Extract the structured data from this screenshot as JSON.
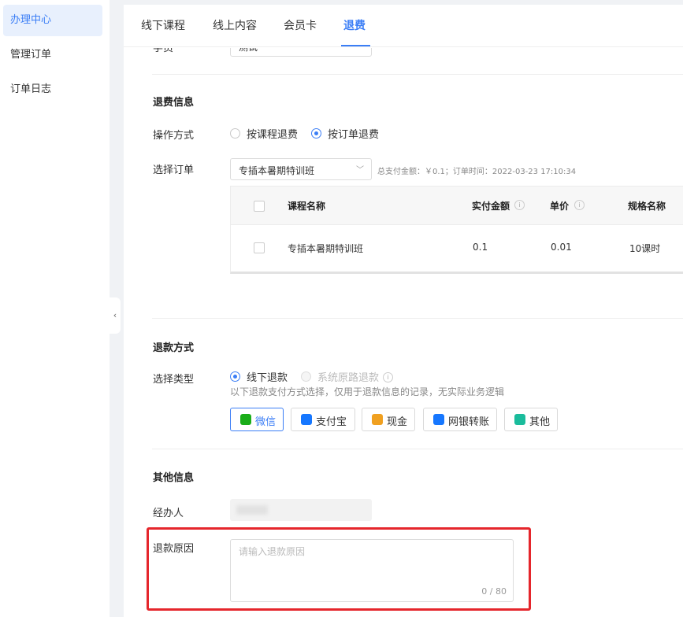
{
  "sidebar": {
    "items": [
      {
        "label": "办理中心"
      },
      {
        "label": "管理订单"
      },
      {
        "label": "订单日志"
      }
    ]
  },
  "tabs": [
    {
      "label": "线下课程"
    },
    {
      "label": "线上内容"
    },
    {
      "label": "会员卡"
    },
    {
      "label": "退费"
    }
  ],
  "top_partial": {
    "label": "学员",
    "value": "测试"
  },
  "refund_info": {
    "title": "退费信息",
    "operation_label": "操作方式",
    "operation_options": [
      "按课程退费",
      "按订单退费"
    ],
    "order_label": "选择订单",
    "order_selected": "专插本暑期特训班",
    "order_hint": "总支付金额：￥0.1；订单时间：2022-03-23 17:10:34"
  },
  "order_table": {
    "columns": [
      "课程名称",
      "实付金额",
      "单价",
      "规格名称"
    ],
    "rows": [
      {
        "name": "专插本暑期特训班",
        "paid": "0.1",
        "unit_price": "0.01",
        "spec": "10课时"
      }
    ]
  },
  "refund_method": {
    "title": "退款方式",
    "type_label": "选择类型",
    "options": [
      "线下退款",
      "系统原路退款"
    ],
    "note": "以下退款支付方式选择，仅用于退款信息的记录，无实际业务逻辑",
    "pay_methods": [
      {
        "label": "微信",
        "icon": "wechat-icon",
        "color": "#1aad19"
      },
      {
        "label": "支付宝",
        "icon": "alipay-icon",
        "color": "#1677ff"
      },
      {
        "label": "现金",
        "icon": "cash-icon",
        "color": "#f0a020"
      },
      {
        "label": "网银转账",
        "icon": "bank-card-icon",
        "color": "#1677ff"
      },
      {
        "label": "其他",
        "icon": "grid-icon",
        "color": "#1abc9c"
      }
    ]
  },
  "other_info": {
    "title": "其他信息",
    "handler_label": "经办人",
    "reason_label": "退款原因",
    "reason_placeholder": "请输入退款原因",
    "reason_count": "0 / 80"
  },
  "colors": {
    "accent": "#3b7ef6",
    "highlight_box": "#e5262c"
  }
}
